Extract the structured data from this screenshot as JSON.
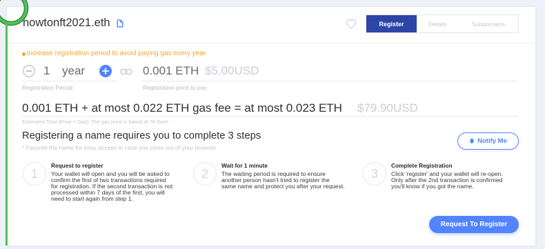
{
  "colors": {
    "accent": "#5284ff",
    "active_tab": "#2c46a6",
    "warning": "#f5a623",
    "highlight": "#4cc35a"
  },
  "icons": {
    "copy": "copy-icon",
    "favorite": "heart-icon",
    "decrease": "minus-icon",
    "increase": "plus-icon",
    "link": "link-icon",
    "notify": "bell-icon",
    "warning": "info-dot-icon"
  },
  "header": {
    "domain": "howtonft2021.eth",
    "tabs": [
      {
        "label": "Register",
        "active": true
      },
      {
        "label": "Details",
        "active": false
      },
      {
        "label": "Subdomains",
        "active": false
      }
    ]
  },
  "registration": {
    "warning": "Increase registration period to avoid paying gas every year",
    "period_value": "1",
    "period_unit": "year",
    "period_label": "Registration Period",
    "price_eth": "0.001 ETH",
    "price_usd": "$5.00USD",
    "price_label": "Registration price to pay",
    "total_eth": "0.001 ETH + at most 0.022 ETH gas fee = at most 0.023 ETH",
    "total_usd": "$79.90USD",
    "total_note": "Estimated Total (Price + Gas). The gas price is based at 78 Gwei"
  },
  "steps": {
    "heading": "Registering a name requires you to complete 3 steps",
    "note": "* Favorite the name for easy access in case you close out of your browser.",
    "notify_label": "Notify Me",
    "items": [
      {
        "number": "1",
        "title": "Request to register",
        "lines": [
          "Your wallet will open and you will be asked to",
          "confirm the first of two transactions required",
          "for registration. If the second transaction is not",
          "processed within 7 days of the first, you will",
          "need to start again from step 1."
        ]
      },
      {
        "number": "2",
        "title": "Wait for 1 minute",
        "lines": [
          "The waiting period is required to ensure",
          "another person hasn't tried to register the",
          "same name and protect you after your request."
        ]
      },
      {
        "number": "3",
        "title": "Complete Registration",
        "lines": [
          "Click 'register' and your wallet will re-open.",
          "Only after the 2nd transaction is confirmed",
          "you'll know if you got the name."
        ]
      }
    ],
    "cta_label": "Request To Register"
  }
}
